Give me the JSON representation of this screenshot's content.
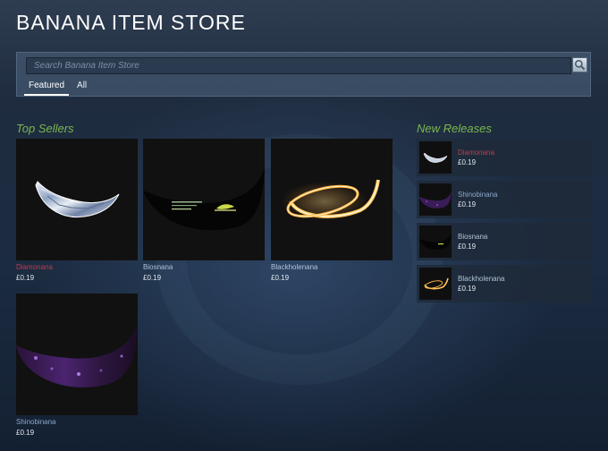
{
  "header": {
    "title": "BANANA ITEM STORE"
  },
  "search": {
    "placeholder": "Search Banana Item Store",
    "tabs": [
      {
        "label": "Featured",
        "active": true
      },
      {
        "label": "All",
        "active": false
      }
    ]
  },
  "colors": {
    "section_title": "#7ab74f",
    "rare_name": "#c7374c",
    "common_name": "#b0c3d9",
    "uncommon_name": "#8ba7c9"
  },
  "top_sellers": {
    "title": "Top Sellers",
    "items": [
      {
        "name": "Diamonana",
        "price": "£0.19",
        "name_color": "#c7374c",
        "art": "diamond-banana"
      },
      {
        "name": "Biosnana",
        "price": "£0.19",
        "name_color": "#b0c3d9",
        "art": "bio-banana"
      },
      {
        "name": "Blackholenana",
        "price": "£0.19",
        "name_color": "#b0c3d9",
        "art": "blackhole-banana"
      },
      {
        "name": "Shinobinana",
        "price": "£0.19",
        "name_color": "#8ba7c9",
        "art": "shinobi-banana"
      }
    ]
  },
  "new_releases": {
    "title": "New Releases",
    "items": [
      {
        "name": "Diamonana",
        "price": "£0.19",
        "name_color": "#c7374c",
        "art": "diamond-banana"
      },
      {
        "name": "Shinobinana",
        "price": "£0.19",
        "name_color": "#8ba7c9",
        "art": "shinobi-banana"
      },
      {
        "name": "Biosnana",
        "price": "£0.19",
        "name_color": "#b0c3d9",
        "art": "bio-banana"
      },
      {
        "name": "Blackholenana",
        "price": "£0.19",
        "name_color": "#b0c3d9",
        "art": "blackhole-banana"
      }
    ]
  }
}
